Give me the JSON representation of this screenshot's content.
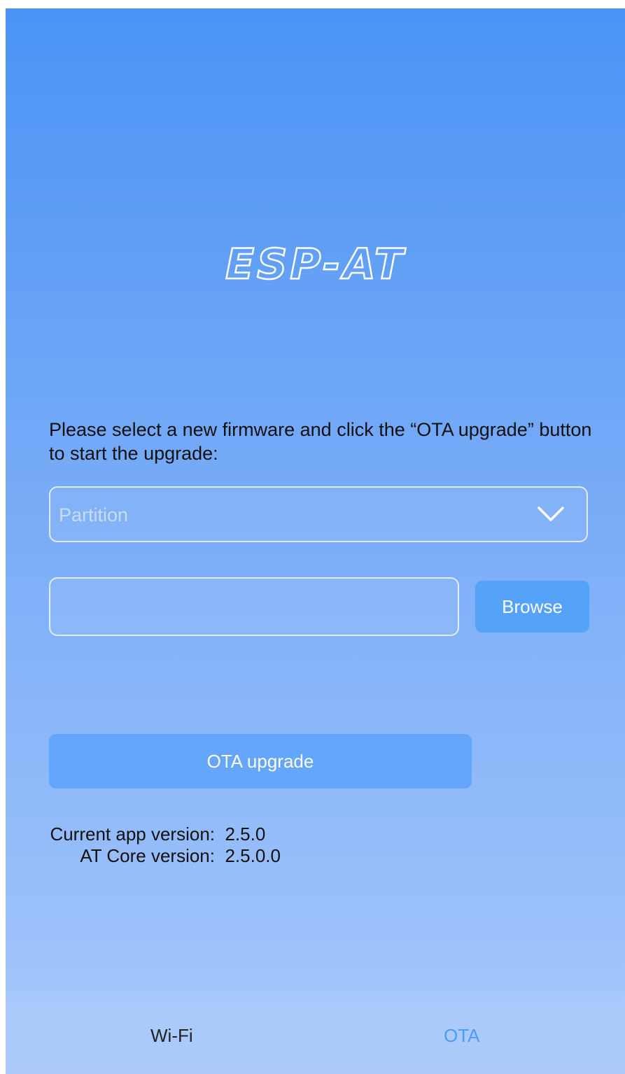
{
  "app": {
    "logo_text": "ESP-AT"
  },
  "ota": {
    "instruction": "Please select a new firmware and click the “OTA upgrade” button to start the upgrade:",
    "partition_placeholder": "Partition",
    "file_value": "",
    "browse_label": "Browse",
    "upgrade_label": "OTA upgrade"
  },
  "versions": {
    "app_label": "Current app version:",
    "app_value": "2.5.0",
    "core_label": "AT Core version:",
    "core_value": "2.5.0.0"
  },
  "tabs": [
    {
      "label": "Wi-Fi",
      "selected": false
    },
    {
      "label": "OTA",
      "selected": true
    }
  ],
  "colors": {
    "gradient_top": "#4a93f5",
    "gradient_bottom": "#a8c8fb",
    "accent": "#4d9bf7",
    "button": "#55a3f8"
  }
}
